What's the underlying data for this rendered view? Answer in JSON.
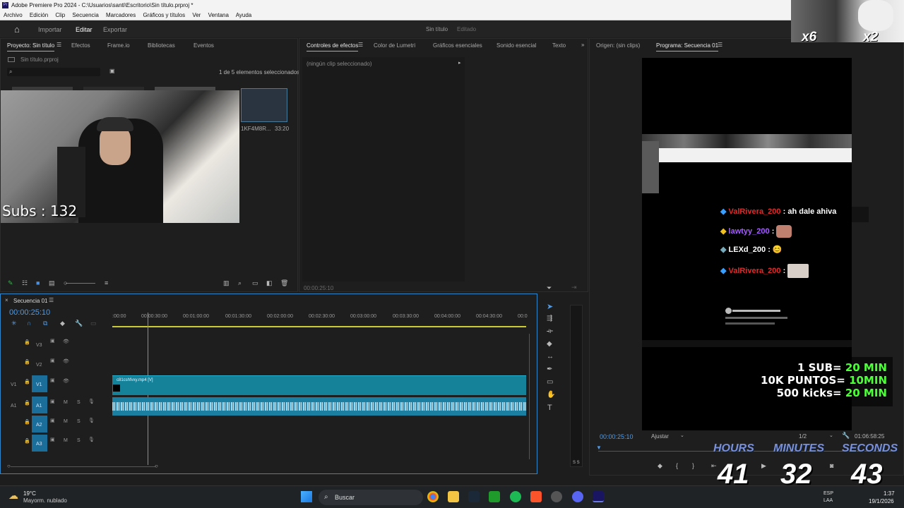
{
  "window": {
    "title": "Adobe Premiere Pro 2024 - C:\\Usuarios\\santi\\Escritorio\\Sin título.prproj *"
  },
  "menu": [
    "Archivo",
    "Edición",
    "Clip",
    "Secuencia",
    "Marcadores",
    "Gráficos y títulos",
    "Ver",
    "Ventana",
    "Ayuda"
  ],
  "workspace": {
    "tabs": [
      "Importar",
      "Editar",
      "Exportar"
    ],
    "active": "Editar",
    "project_title": "Sin título",
    "status": "Editado"
  },
  "project_panel": {
    "tabs": [
      "Proyecto: Sin título",
      "Efectos",
      "Frame.io",
      "Bibliotecas",
      "Eventos"
    ],
    "file": "Sin título.prproj",
    "selection": "1 de 5 elementos seleccionados",
    "clip_name": "1KF4M8R...",
    "clip_duration": "33:20"
  },
  "effects_panel": {
    "tabs": [
      "Controles de efectos",
      "Color de Lumetri",
      "Gráficos esenciales",
      "Sonido esencial",
      "Texto"
    ],
    "empty": "(ningún clip seleccionado)",
    "timecode": "00:00:25:10"
  },
  "program_panel": {
    "tabs": [
      "Origen: (sin clips)",
      "Programa: Secuencia 01"
    ],
    "timecode": "00:00:25:10",
    "fit": "Ajustar",
    "quality": "1/2",
    "duration": "01:06:58:25"
  },
  "timeline": {
    "tab": "Secuencia 01",
    "timecode": "00:00:25:10",
    "ruler": [
      ":00:00",
      "00:00:30:00",
      "00:01:00:00",
      "00:01:30:00",
      "00:02:00:00",
      "00:02:30:00",
      "00:03:00:00",
      "00:03:30:00",
      "00:04:00:00",
      "00:04:30:00",
      "00:0"
    ],
    "video_tracks": [
      "V3",
      "V2",
      "V1"
    ],
    "audio_tracks": [
      "A1",
      "A2",
      "A3"
    ],
    "clip_label": "c81cshfvxy.mp4 [V]",
    "track_buttons": {
      "mute": "M",
      "solo": "S"
    },
    "meter_labels": "S S"
  },
  "stream_overlay": {
    "subs": "Subs : 132",
    "multipliers": [
      "x6",
      "x2"
    ],
    "chat": [
      {
        "user": "ValRivera_200",
        "msg": ": ah dale ahiva",
        "color": "#e02b2b"
      },
      {
        "user": "lawtyy_200",
        "msg": ":",
        "color": "#a55cff"
      },
      {
        "user": "LEXd_200",
        "msg": ": 😊",
        "color": "#ffffff"
      },
      {
        "user": "ValRivera_200",
        "msg": ":",
        "color": "#e02b2b"
      }
    ],
    "rules": [
      {
        "left": "1 SUB= ",
        "right": "20 MIN"
      },
      {
        "left": "10K PUNTOS= ",
        "right": "10MIN"
      },
      {
        "left": "500 kicks= ",
        "right": "20 MIN"
      }
    ],
    "timer_labels": [
      "HOURS",
      "MINUTES",
      "SECONDS"
    ],
    "timer_values": [
      "41",
      "32",
      "43"
    ]
  },
  "taskbar": {
    "weather_temp": "19°C",
    "weather_desc": "Mayorm. nublado",
    "search": "Buscar",
    "lang1": "ESP",
    "lang2": "LAA",
    "time": "1:37",
    "date": "19/1/2026"
  }
}
